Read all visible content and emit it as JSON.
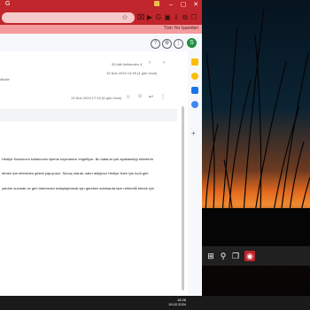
{
  "browser": {
    "tab_title": "G",
    "window_buttons": [
      "⌄",
      "–",
      "▢",
      "✕"
    ],
    "toolbar_icons": [
      "☆",
      "⌧",
      "▶",
      "G",
      "▣",
      "⇩",
      "⧉",
      "☐"
    ],
    "bookmark_label": "Tüm Yer İşaretleri"
  },
  "gmail": {
    "avatar_letter": "S",
    "pagination": "53 Adlı iletisinden 4",
    "date1": "15 Şub 2024 14:39 (4 gün önce)",
    "recipient_hint": "iliscile",
    "date2": "13 Şub 2024 17:24 (6 gün önce)",
    "lines": [
      "Hediye Kartımızın kullanımını işleme koymamızı engelliyor. Bu hatanın çok ayaklandığı ekimlerin",
      "etmek için elimizden geleni yapıyoruz. Sonuç olarak, satın aldığınız Hediye Kartı için kodi geri",
      "yardım sunmak ve geri ödemenizi kolaylaştırmak için gereken adımlarda size rehberlik etmek için"
    ]
  },
  "taskbar": {
    "time": "18:26",
    "date": "19.02.2024"
  },
  "colors": {
    "chrome_red": "#c0262c",
    "bookmarks_pink": "#f49b9e",
    "avatar_green": "#1e8e3e"
  }
}
